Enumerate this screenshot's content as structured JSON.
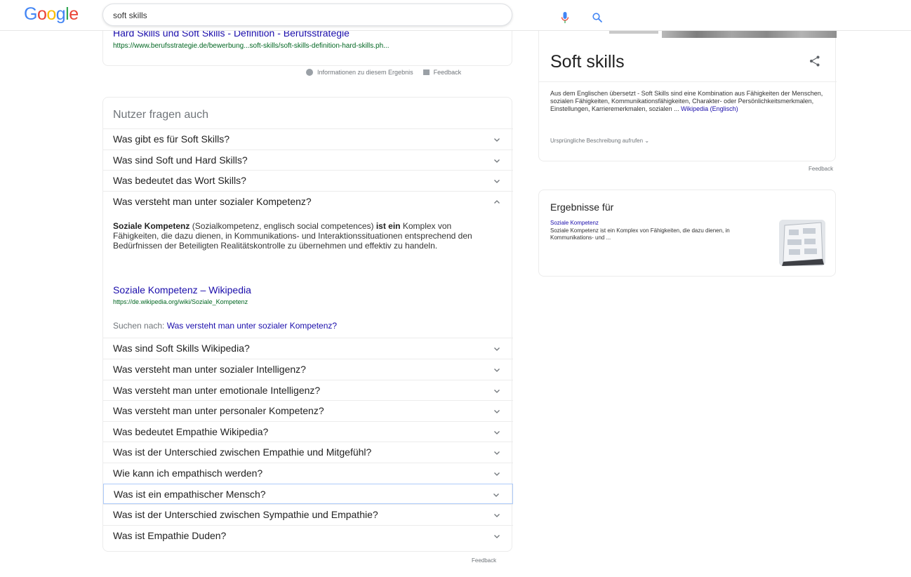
{
  "header": {
    "logo_text": "Google",
    "search_value": "soft skills"
  },
  "previous_result": {
    "title": "Hard Skills und Soft Skills - Definition - Berufsstrategie",
    "url": "https://www.berufsstrategie.de/bewerbung...soft-skills/soft-skills-definition-hard-skills.ph...",
    "info_label": "Informationen zu diesem Ergebnis",
    "feedback_label": "Feedback"
  },
  "people_also_ask": {
    "title": "Nutzer fragen auch",
    "questions_top": [
      "Was gibt es für Soft Skills?",
      "Was sind Soft und Hard Skills?",
      "Was bedeutet das Wort Skills?",
      "Was versteht man unter sozialer Kompetenz?"
    ],
    "answer": {
      "bold_start": "Soziale Kompetenz",
      "text_mid": " (Sozialkompetenz, englisch social competences) ",
      "bold_mid": "ist ein",
      "text_rest": " Komplex von Fähigkeiten, die dazu dienen, in Kommunikations- und Interaktionssituationen entsprechend den Bedürfnissen der Beteiligten Realitätskontrolle zu übernehmen und effektiv zu handeln.",
      "link_title": "Soziale Kompetenz – Wikipedia",
      "link_url": "https://de.wikipedia.org/wiki/Soziale_Kompetenz",
      "search_prefix": "Suchen nach: ",
      "search_link": "Was versteht man unter sozialer Kompetenz?"
    },
    "questions_bottom": [
      "Was sind Soft Skills Wikipedia?",
      "Was versteht man unter sozialer Intelligenz?",
      "Was versteht man unter emotionale Intelligenz?",
      "Was versteht man unter personaler Kompetenz?",
      "Was bedeutet Empathie Wikipedia?",
      "Was ist der Unterschied zwischen Empathie und Mitgefühl?",
      "Wie kann ich empathisch werden?",
      "Was ist ein empathischer Mensch?",
      "Was ist der Unterschied zwischen Sympathie und Empathie?",
      "Was ist Empathie Duden?"
    ],
    "feedback_label": "Feedback"
  },
  "knowledge_panel": {
    "title": "Soft skills",
    "description": "Aus dem Englischen übersetzt - Soft Skills sind eine Kombination aus Fähigkeiten der Menschen, sozialen Fähigkeiten, Kommunikationsfähigkeiten, Charakter- oder Persönlichkeitsmerkmalen, Einstellungen, Karrieremerkmalen, sozialen ... ",
    "description_link": "Wikipedia (Englisch)",
    "original_label": "Ursprüngliche Beschreibung aufrufen",
    "feedback_label": "Feedback"
  },
  "results_for": {
    "title": "Ergebnisse für",
    "link": "Soziale Kompetenz",
    "snippet": "Soziale Kompetenz ist ein Komplex von Fähigkeiten, die dazu dienen, in Kommunikations- und ..."
  },
  "colors": {
    "link": "#1a0dab",
    "url": "#006621",
    "muted": "#70757a"
  }
}
